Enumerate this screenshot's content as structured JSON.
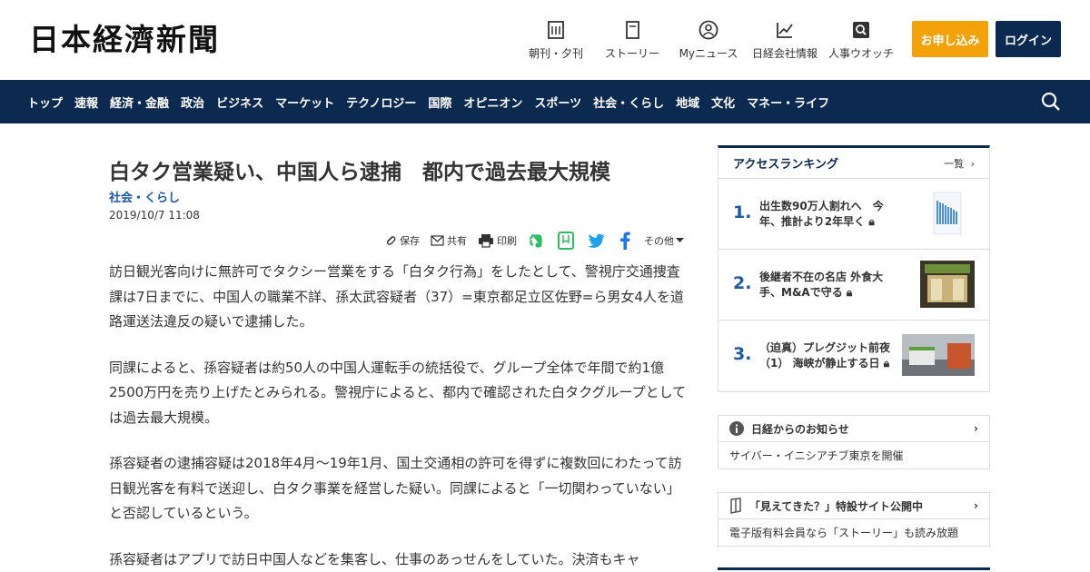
{
  "header": {
    "logo": "日本経濟新聞",
    "tools": [
      {
        "label": "朝刊・夕刊",
        "icon": "newspaper-icon"
      },
      {
        "label": "ストーリー",
        "icon": "book-icon"
      },
      {
        "label": "Myニュース",
        "icon": "user-icon"
      },
      {
        "label": "日経会社情報",
        "icon": "chart-icon"
      },
      {
        "label": "人事ウオッチ",
        "icon": "search-person-icon"
      }
    ],
    "apply_label": "お申し込み",
    "login_label": "ログイン"
  },
  "nav": {
    "items": [
      "トップ",
      "速報",
      "経済・金融",
      "政治",
      "ビジネス",
      "マーケット",
      "テクノロジー",
      "国際",
      "オピニオン",
      "スポーツ",
      "社会・くらし",
      "地域",
      "文化",
      "マネー・ライフ"
    ]
  },
  "article": {
    "title": "白タク営業疑い、中国人ら逮捕　都内で過去最大規模",
    "category": "社会・くらし",
    "date": "2019/10/7 11:08",
    "share": {
      "save": "保存",
      "share": "共有",
      "print": "印刷",
      "other": "その他"
    },
    "paragraphs": [
      "訪日観光客向けに無許可でタクシー営業をする「白タク行為」をしたとして、警視庁交通捜査課は7日までに、中国人の職業不詳、孫太武容疑者（37）=東京都足立区佐野=ら男女4人を道路運送法違反の疑いで逮捕した。",
      "同課によると、孫容疑者は約50人の中国人運転手の統括役で、グループ全体で年間で約1億2500万円を売り上げたとみられる。警視庁によると、都内で確認された白タクグループとしては過去最大規模。",
      "孫容疑者の逮捕容疑は2018年4月～19年1月、国土交通相の許可を得ずに複数回にわたって訪日観光客を有料で送迎し、白タク事業を経営した疑い。同課によると「一切関わっていない」と否認しているという。",
      "孫容疑者はアプリで訪日中国人などを集客し、仕事のあっせんをしていた。決済もキャ"
    ]
  },
  "sidebar": {
    "ranking": {
      "title": "アクセスランキング",
      "more": "一覧",
      "items": [
        {
          "rank": "1.",
          "text": "出生数90万人割れへ　今年、推計より2年早く"
        },
        {
          "rank": "2.",
          "text": "後継者不在の名店 外食大手、M&Aで守る"
        },
        {
          "rank": "3.",
          "text": "（迫真）プレグジット前夜（1） 海峡が静止する日"
        }
      ]
    },
    "notice1": {
      "title": "日経からのお知らせ",
      "body": "サイバー・イニシアチブ東京を開催"
    },
    "notice2": {
      "title": "「見えてきた？」特設サイト公開中",
      "body": "電子版有料会員なら「ストーリー」も読み放題"
    }
  },
  "colors": {
    "navy": "#0c2a4f",
    "orange": "#f4a20a",
    "link_blue": "#1a5aa8"
  }
}
